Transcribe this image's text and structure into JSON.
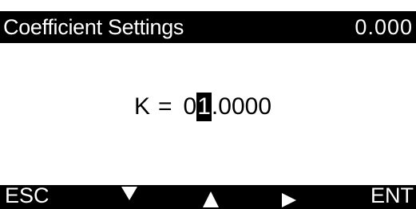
{
  "header": {
    "title": "Coefficient Settings",
    "value": "0.000"
  },
  "editor": {
    "label": "K",
    "equals": "=",
    "digits": [
      "0",
      "1",
      ".",
      "0",
      "0",
      "0",
      "0"
    ],
    "cursor_index": 1
  },
  "softkeys": {
    "esc_label": "ESC",
    "down_icon": "down-triangle-icon",
    "up_icon": "up-triangle-icon",
    "right_icon": "right-triangle-icon",
    "ent_label": "ENT"
  },
  "colors": {
    "bar_background": "#000000",
    "bar_text": "#ffffff",
    "page_background": "#ffffff"
  }
}
